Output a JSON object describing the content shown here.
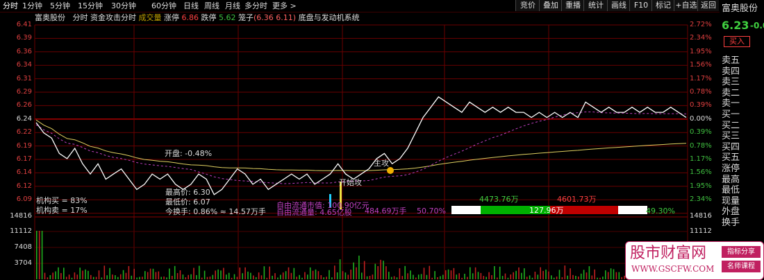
{
  "tabs": [
    "分时",
    "1分钟",
    "5分钟",
    "15分钟",
    "30分钟",
    "60分钟",
    "日线",
    "周线",
    "月线",
    "多分时",
    "更多 >"
  ],
  "right_buttons": [
    "竞价",
    "叠加",
    "重播",
    "统计",
    "画线",
    "F10",
    "标记",
    "+自选",
    "返回"
  ],
  "header": {
    "stock_name": "富奥股份",
    "items": [
      "分时",
      "资金攻击分时",
      "成交量"
    ],
    "limit_up_label": "涨停",
    "limit_up_value": "6.86",
    "limit_down_label": "跌停",
    "limit_down_value": "5.62",
    "cage_label": "笼子",
    "cage_value": "(6.36 6.11)",
    "system_label": "底盘与发动机系统"
  },
  "price_axis_left": [
    "6.41",
    "6.39",
    "6.36",
    "6.34",
    "6.31",
    "6.29",
    "6.26",
    "6.24",
    "6.22",
    "6.19",
    "6.17",
    "6.14",
    "6.12",
    "6.09"
  ],
  "pct_axis_right": [
    "2.72%",
    "2.34%",
    "1.95%",
    "1.56%",
    "1.17%",
    "0.78%",
    "0.39%",
    "0.00%",
    "0.39%",
    "0.78%",
    "1.17%",
    "1.56%",
    "1.95%",
    "2.34%"
  ],
  "volume_axis": [
    "14816",
    "11112",
    "7408",
    "3704"
  ],
  "annotations": {
    "open": "开盘: -0.48%",
    "high": "最高价: 6.30",
    "low": "最低价: 6.07",
    "turnover": "今换手: 0.86% ≈ 14.57万手",
    "inst_buy": "机构买 = 83%",
    "inst_sell": "机构卖 = 17%",
    "main_attack": "主攻",
    "start_attack": "开始攻",
    "float_value": "自由流通市值: 100.90亿元",
    "float_shares": "自由流通量: 4.65亿股",
    "vol_text": "484.69万手",
    "ratio_left": "50.70%",
    "bar_top_left": "4473.76万",
    "bar_top_right": "4601.73万",
    "bar_center": "127.96万",
    "ratio_right": "49.30%"
  },
  "right_panel": {
    "stock_name": "富奥股份",
    "price": "6.23",
    "change": "-0.0",
    "buy_button": "买入",
    "rows": [
      "卖五",
      "卖四",
      "卖三",
      "卖二",
      "卖一",
      "买一",
      "买二",
      "买三",
      "买四",
      "买五",
      "涨停",
      "最高",
      "最低",
      "现量",
      "外盘",
      "换手"
    ]
  },
  "watermark": {
    "title": "股市财富网",
    "url": "WWW.GSCFW.COM",
    "tag1": "指标分享",
    "tag2": "名师课程"
  },
  "colors": {
    "grid": "#8b0000",
    "price_line": "#ffffff",
    "avg_line": "#e0d060",
    "dash_line": "#c040c0",
    "green": "#00c000",
    "red": "#c00000"
  },
  "chart_data": {
    "type": "line",
    "x_label": "",
    "ylim": [
      6.07,
      6.41
    ],
    "series": [
      {
        "values": [
          6.22,
          6.2,
          6.19,
          6.16,
          6.15,
          6.17,
          6.14,
          6.12,
          6.14,
          6.11,
          6.12,
          6.13,
          6.11,
          6.09,
          6.1,
          6.12,
          6.11,
          6.12,
          6.1,
          6.09,
          6.1,
          6.12,
          6.11,
          6.08,
          6.09,
          6.11,
          6.13,
          6.12,
          6.1,
          6.11,
          6.09,
          6.1,
          6.11,
          6.12,
          6.11,
          6.12,
          6.1,
          6.11,
          6.12,
          6.14,
          6.12,
          6.11,
          6.12,
          6.13,
          6.15,
          6.16,
          6.14,
          6.15,
          6.17,
          6.2,
          6.23,
          6.25,
          6.27,
          6.26,
          6.25,
          6.24,
          6.26,
          6.25,
          6.24,
          6.25,
          6.24,
          6.25,
          6.24,
          6.24,
          6.23,
          6.24,
          6.23,
          6.24,
          6.23,
          6.24,
          6.23,
          6.26,
          6.25,
          6.24,
          6.25,
          6.24,
          6.24,
          6.25,
          6.24,
          6.25,
          6.24,
          6.24,
          6.25,
          6.24,
          6.23
        ]
      }
    ]
  }
}
